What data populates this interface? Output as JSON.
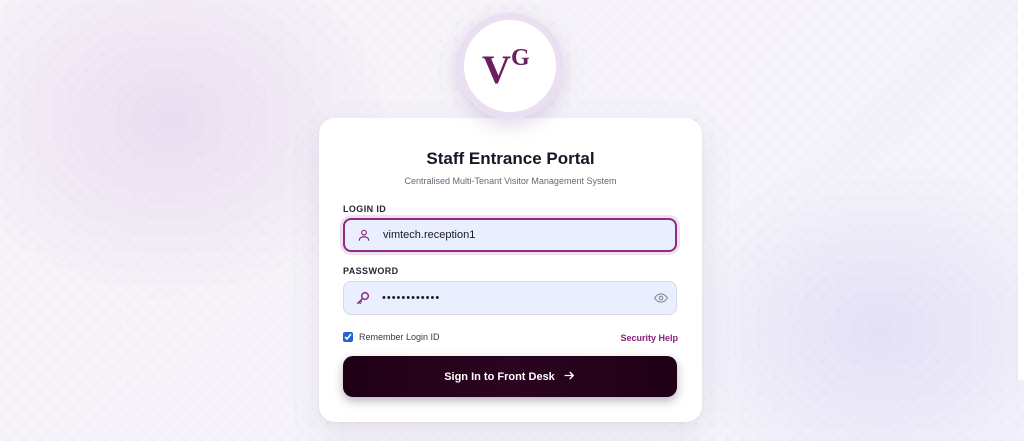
{
  "logo": {
    "letters": "VG",
    "primary_letter": "V",
    "secondary_letter": "G",
    "color": "#6b1f5e"
  },
  "card": {
    "title": "Staff Entrance Portal",
    "subtitle": "Centralised Multi-Tenant Visitor Management System"
  },
  "login": {
    "label": "LOGIN ID",
    "value": "vimtech.reception1",
    "icon": "user-icon"
  },
  "password": {
    "label": "PASSWORD",
    "value": "••••••••••••",
    "icon": "key-icon",
    "toggle_icon": "eye-icon"
  },
  "remember": {
    "label": "Remember Login ID",
    "checked": true
  },
  "help_link": "Security Help",
  "submit": {
    "label": "Sign In to Front Desk",
    "icon": "arrow-right-icon"
  },
  "colors": {
    "accent": "#8e2d7f",
    "button": "#1f0015",
    "field_bg": "#e9efff"
  }
}
